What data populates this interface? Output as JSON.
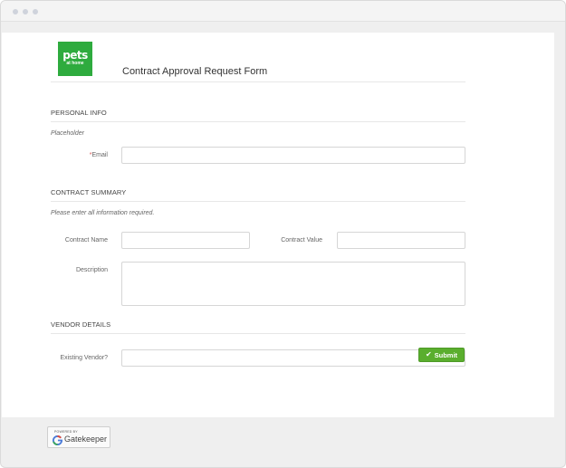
{
  "app": {
    "logo_text_main": "pets",
    "logo_text_sub": "at home",
    "form_title": "Contract Approval Request Form"
  },
  "personal_info": {
    "heading": "PERSONAL INFO",
    "note": "Placeholder",
    "email_label": "Email",
    "required_marker": "*",
    "email_value": "",
    "email_placeholder": ""
  },
  "contract_summary": {
    "heading": "CONTRACT SUMMARY",
    "note": "Please enter all information required.",
    "contract_name_label": "Contract Name",
    "contract_name_value": "",
    "contract_value_label": "Contract Value",
    "contract_value_value": "",
    "description_label": "Description",
    "description_value": ""
  },
  "vendor_details": {
    "heading": "VENDOR DETAILS",
    "existing_vendor_label": "Existing Vendor?",
    "existing_vendor_selected": "",
    "clear_glyph": "✕",
    "chevron_glyph": "⌄"
  },
  "actions": {
    "submit_label": "Submit",
    "submit_icon": "check-icon"
  },
  "footer": {
    "powered_by": "POWERED BY",
    "brand_name": "Gatekeeper"
  },
  "colors": {
    "brand_green": "#2eab3e",
    "submit_green": "#5aae2e",
    "required_red": "#d9534f"
  }
}
